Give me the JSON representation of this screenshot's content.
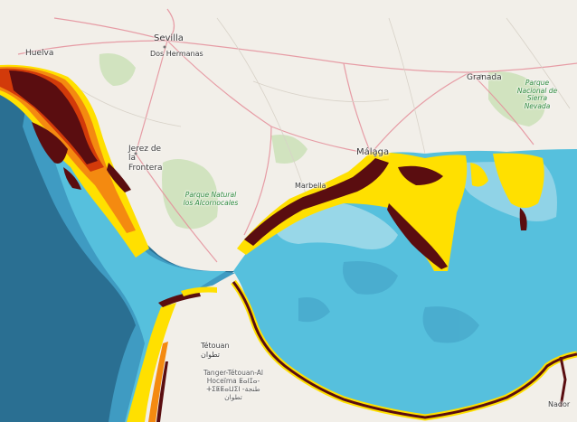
{
  "map": {
    "labels": {
      "sevilla": "Sevilla",
      "dos_hermanas": "Dos Hermanas",
      "huelva": "Huelva",
      "jerez": "Jerez de la Frontera",
      "granada": "Granada",
      "malaga": "Málaga",
      "marbella": "Marbella",
      "tetouan": "Tétouan ﺗﻄﻮﺍﻥ",
      "tanger_region": "Tanger-Tétouan-Al Hoceïma ⵟⴰⵏⵊⴰ-ⵜⵉⵟⵟⴰⵡⵉⵏ ﻃﻨﺠﺔ-ﺗﻄﻮﺍﻥ",
      "nador": "Nador",
      "park_alcornocales": "Parque Natural los Alcornocales",
      "park_sierra_nevada": "Parque Nacional de Sierra Nevada"
    },
    "colors": {
      "land": "#f2efe9",
      "deep_sea": "#2a6f92",
      "mid_sea": "#3f9bc2",
      "shelf_sea": "#56c0dd",
      "coastal_light": "#a9dceb",
      "concentration_yellow": "#ffe000",
      "concentration_orange": "#f48a10",
      "concentration_red": "#d23a0a",
      "concentration_dark": "#5a0d10",
      "road": "#e58e9a",
      "park_green": "#c8e0b4"
    }
  }
}
